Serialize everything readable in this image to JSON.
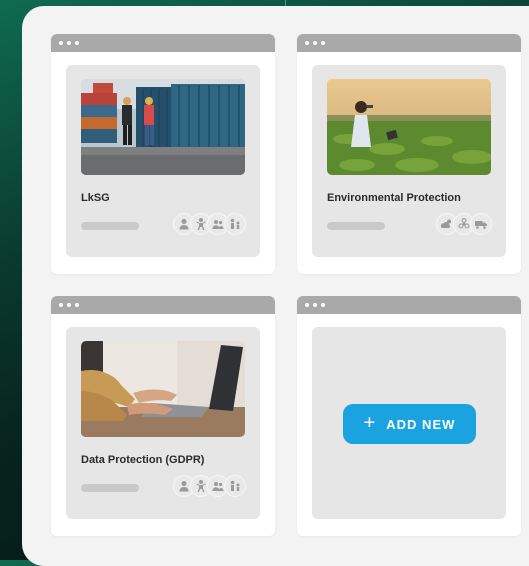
{
  "cards": [
    {
      "title": "LkSG",
      "photo": "workers-in-container-yard",
      "avatars": [
        "person-icon",
        "worker-icon",
        "users-icon",
        "family-icon"
      ]
    },
    {
      "title": "Environmental Protection",
      "photo": "woman-in-crop-field-with-tablet",
      "avatars": [
        "sun-cloud-icon",
        "biohazard-icon",
        "truck-icon"
      ]
    },
    {
      "title": "Data Protection (GDPR)",
      "photo": "hands-typing-on-laptop",
      "avatars": [
        "person-icon",
        "worker-icon",
        "users-icon",
        "family-icon"
      ]
    }
  ],
  "add_new": {
    "icon": "plus-icon",
    "label": "ADD NEW"
  },
  "colors": {
    "accent": "#1aa3e0",
    "window_bar": "#a9a9a9",
    "card_bg": "#e6e6e6",
    "panel_bg": "#f3f3f3",
    "background_green": "#0f6b4f"
  }
}
